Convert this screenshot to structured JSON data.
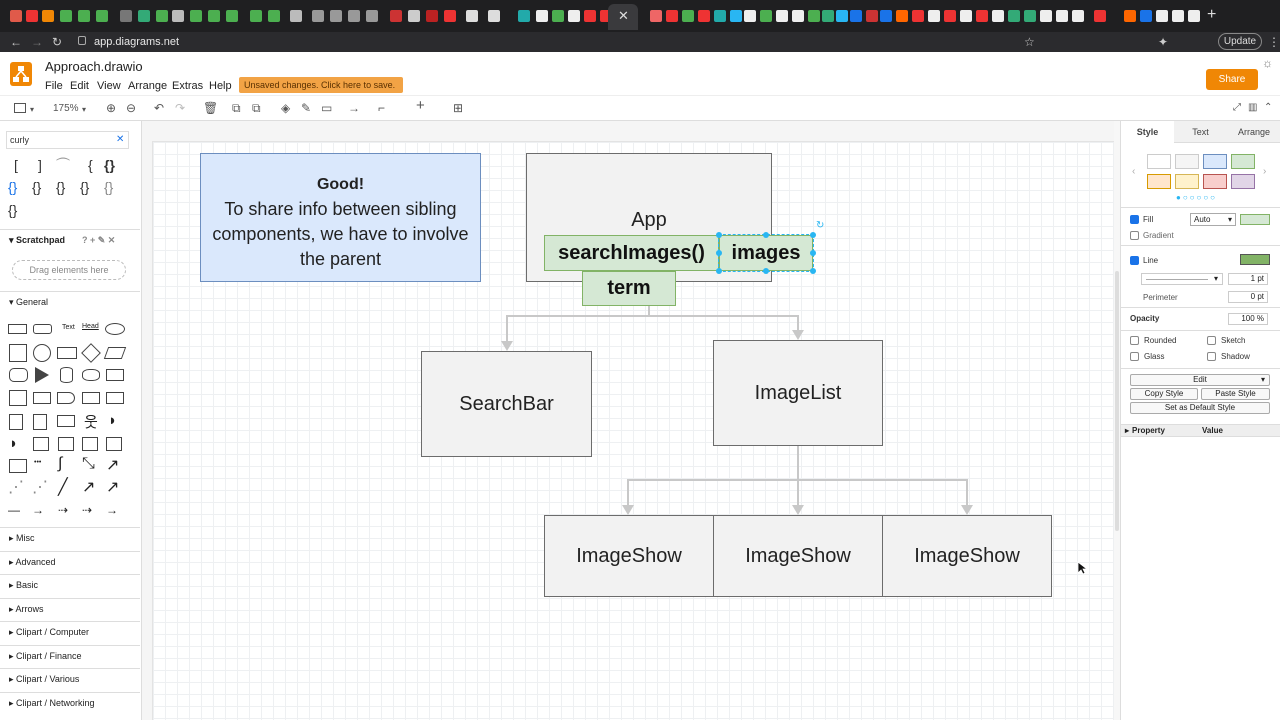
{
  "browser": {
    "url": "app.diagrams.net",
    "update_label": "Update"
  },
  "app": {
    "title": "Approach.drawio",
    "menus": [
      "File",
      "Edit",
      "View",
      "Arrange",
      "Extras",
      "Help"
    ],
    "unsaved_notice": "Unsaved changes. Click here to save.",
    "share_label": "Share",
    "accent_color": "#f08705"
  },
  "toolbar": {
    "zoom": "175%"
  },
  "left_panel": {
    "search_value": "curly",
    "scratchpad_title": "Scratchpad",
    "drag_hint": "Drag elements here",
    "general_title": "General",
    "sections": [
      "Misc",
      "Advanced",
      "Basic",
      "Arrows",
      "Clipart / Computer",
      "Clipart / Finance",
      "Clipart / Various",
      "Clipart / Networking"
    ]
  },
  "diagram": {
    "note_title": "Good!",
    "note_body": "To share info between sibling components, we have to involve the parent",
    "app_label": "App",
    "search_images_label": "searchImages()",
    "images_label": "images",
    "term_label": "term",
    "searchbar_label": "SearchBar",
    "imagelist_label": "ImageList",
    "imageshow_labels": [
      "ImageShow",
      "ImageShow",
      "ImageShow"
    ]
  },
  "right_panel": {
    "tabs": [
      "Style",
      "Text",
      "Arrange"
    ],
    "fill_label": "Fill",
    "fill_mode": "Auto",
    "gradient_label": "Gradient",
    "line_label": "Line",
    "line_width": "1 pt",
    "perimeter_label": "Perimeter",
    "perimeter_value": "0 pt",
    "opacity_label": "Opacity",
    "opacity_value": "100 %",
    "rounded_label": "Rounded",
    "sketch_label": "Sketch",
    "glass_label": "Glass",
    "shadow_label": "Shadow",
    "edit_label": "Edit",
    "copy_style_label": "Copy Style",
    "paste_style_label": "Paste Style",
    "set_default_label": "Set as Default Style",
    "property_header": "Property",
    "value_header": "Value"
  }
}
